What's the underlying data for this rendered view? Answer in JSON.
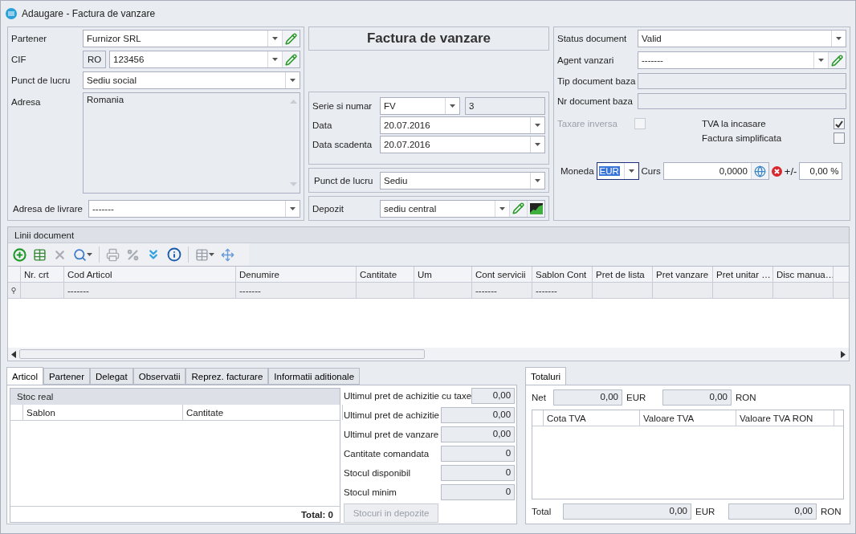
{
  "window": {
    "title": "Adaugare - Factura de vanzare"
  },
  "partner": {
    "partener": {
      "label": "Partener",
      "value": "Furnizor SRL"
    },
    "cif": {
      "label": "CIF",
      "prefix": "RO",
      "value": "123456"
    },
    "punct_de_lucru": {
      "label": "Punct de lucru",
      "value": "Sediu social"
    },
    "adresa": {
      "label": "Adresa",
      "value": "Romania"
    },
    "adresa_de_livrare": {
      "label": "Adresa de livrare",
      "value": "-------"
    }
  },
  "document_title": "Factura de vanzare",
  "numbering": {
    "serie": {
      "label": "Serie si numar",
      "value": "FV",
      "number": "3"
    },
    "data": {
      "label": "Data",
      "value": "20.07.2016"
    },
    "data_scadenta": {
      "label": "Data scadenta",
      "value": "20.07.2016"
    }
  },
  "punct_de_lucru": {
    "label": "Punct de lucru",
    "value": "Sediu"
  },
  "depozit": {
    "label": "Depozit",
    "value": "sediu central"
  },
  "status": {
    "status_document": {
      "label": "Status document",
      "value": "Valid"
    },
    "agent_vanzari": {
      "label": "Agent vanzari",
      "value": "-------"
    },
    "tip_document_baza": {
      "label": "Tip document baza"
    },
    "nr_document_baza": {
      "label": "Nr document baza"
    },
    "options": [
      {
        "label": "Taxare inversa",
        "checked": false,
        "disabled": true
      },
      {
        "label": "TVA la incasare",
        "checked": true,
        "disabled": false
      },
      {
        "label": "Factura simplificata",
        "checked": false,
        "disabled": false
      }
    ],
    "moneda": {
      "label": "Moneda",
      "value": "EUR"
    },
    "curs": {
      "label": "Curs",
      "value": "0,0000"
    },
    "adjust": {
      "label": "+/-",
      "value": "0,00 %"
    }
  },
  "lines": {
    "title": "Linii document",
    "columns": [
      "Nr. crt",
      "Cod Articol",
      "Denumire",
      "Cantitate",
      "Um",
      "Cont servicii",
      "Sablon Cont",
      "Pret de lista",
      "Pret vanzare",
      "Pret unitar …",
      "Disc manua…"
    ],
    "rows": [
      {
        "cells": [
          "",
          "-------",
          "-------",
          "",
          "",
          "-------",
          "-------",
          "",
          "",
          "",
          ""
        ]
      }
    ]
  },
  "detail_tabs": [
    {
      "label": "Articol",
      "selected": true
    },
    {
      "label": "Partener",
      "selected": false
    },
    {
      "label": "Delegat",
      "selected": false
    },
    {
      "label": "Observatii",
      "selected": false
    },
    {
      "label": "Reprez. facturare",
      "selected": false
    },
    {
      "label": "Informatii aditionale",
      "selected": false
    }
  ],
  "stock": {
    "title": "Stoc real",
    "columns": [
      "Sablon",
      "Cantitate"
    ],
    "total": "Total: 0"
  },
  "article_info": [
    {
      "label": "Ultimul pret de achizitie cu taxe",
      "value": "0,00"
    },
    {
      "label": "Ultimul pret de achizitie",
      "value": "0,00"
    },
    {
      "label": "Ultimul pret de vanzare",
      "value": "0,00"
    },
    {
      "label": "Cantitate comandata",
      "value": "0"
    },
    {
      "label": "Stocul disponibil",
      "value": "0"
    },
    {
      "label": "Stocul minim",
      "value": "0"
    }
  ],
  "stock_button": "Stocuri in depozite",
  "totals": {
    "tab": "Totaluri",
    "net": {
      "label": "Net",
      "eur": "0,00",
      "eur_unit": "EUR",
      "ron": "0,00",
      "ron_unit": "RON"
    },
    "columns": [
      "Cota TVA",
      "Valoare TVA",
      "Valoare TVA RON"
    ],
    "total": {
      "label": "Total",
      "eur": "0,00",
      "eur_unit": "EUR",
      "ron": "0,00",
      "ron_unit": "RON"
    }
  }
}
